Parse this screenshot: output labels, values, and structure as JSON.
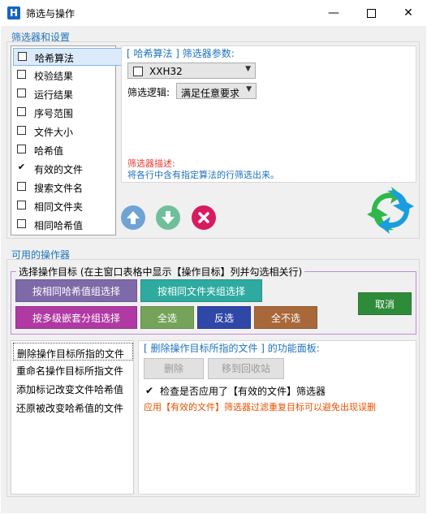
{
  "window": {
    "title": "筛选与操作",
    "icon_letter": "H",
    "minimize_icon": "minimize-icon",
    "maximize_icon": "maximize-icon",
    "close_icon": "close-icon"
  },
  "filter_section": {
    "title": "筛选器和设置",
    "items": [
      {
        "label": "哈希算法",
        "checked": false,
        "selected": true,
        "mark": ""
      },
      {
        "label": "校验结果",
        "checked": false,
        "selected": false,
        "mark": ""
      },
      {
        "label": "运行结果",
        "checked": false,
        "selected": false,
        "mark": ""
      },
      {
        "label": "序号范围",
        "checked": false,
        "selected": false,
        "mark": ""
      },
      {
        "label": "文件大小",
        "checked": false,
        "selected": false,
        "mark": ""
      },
      {
        "label": "哈希值",
        "checked": false,
        "selected": false,
        "mark": ""
      },
      {
        "label": "有效的文件",
        "checked": true,
        "selected": false,
        "mark": "✔"
      },
      {
        "label": "搜索文件名",
        "checked": false,
        "selected": false,
        "mark": ""
      },
      {
        "label": "相同文件夹",
        "checked": false,
        "selected": false,
        "mark": ""
      },
      {
        "label": "相同哈希值",
        "checked": false,
        "selected": false,
        "mark": ""
      }
    ],
    "params_title": "[ 哈希算法 ] 筛选器参数:",
    "algorithm": {
      "label": "XXH32",
      "checked": false
    },
    "logic_label": "筛选逻辑:",
    "logic_value": "满足任意要求",
    "description_title": "筛选器描述:",
    "description_text": "将各行中含有指定算法的行筛选出来。",
    "move_up_icon": "arrow-up-icon",
    "move_down_icon": "arrow-down-icon",
    "remove_icon": "close-icon",
    "apply_icon": "refresh-arrows-icon",
    "colors": {
      "up": "#6fa3d6",
      "down": "#6fbf9a",
      "remove": "#d81b60",
      "desc_title": "#e53935",
      "desc_text": "#1e73be"
    }
  },
  "operations_section": {
    "title": "可用的操作器",
    "target_group_title": "选择操作目标 (在主窗口表格中显示【操作目标】列并勾选相关行)",
    "buttons": {
      "by_hash": "按相同哈希值组选择",
      "by_folder": "按相同文件夹组选择",
      "by_nested": "按多级嵌套分组选择",
      "select_all": "全选",
      "invert": "反选",
      "select_none": "全不选",
      "cancel": "取消"
    },
    "colors": {
      "by_hash": "#7e6aa8",
      "by_folder": "#2eaaa0",
      "by_nested": "#b039a3",
      "select_all": "#76a35a",
      "invert": "#2f47a6",
      "select_none": "#a8683a",
      "cancel": "#2e8b3a"
    },
    "op_items": [
      "删除操作目标所指的文件",
      "重命名操作目标所指文件",
      "添加标记改变文件哈希值",
      "还原被改变哈希值的文件"
    ],
    "panel_title": "[ 删除操作目标所指的文件 ] 的功能面板:",
    "delete_label": "删除",
    "recycle_label": "移到回收站",
    "check_label": "检查是否应用了【有效的文件】筛选器",
    "check_mark": "✔",
    "warning_text": "应用【有效的文件】筛选器过滤重复目标可以避免出现误删",
    "warning_color": "#e65100"
  }
}
